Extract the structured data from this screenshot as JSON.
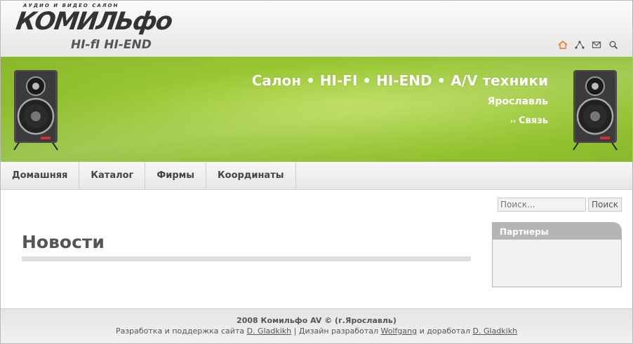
{
  "logo": {
    "tagline": "АУДИО И ВИДЕО САЛОН",
    "name": "КОМИЛЬфо",
    "sub": "HI-fI  HI-END"
  },
  "top_icons": [
    "home-icon",
    "sitemap-icon",
    "mail-icon",
    "search-icon"
  ],
  "banner": {
    "title": "Салон • HI-FI • HI-END • A/V техники",
    "city": "Ярославль",
    "link_arrow": "››",
    "link_label": "Связь"
  },
  "nav": {
    "items": [
      {
        "label": "Домашняя"
      },
      {
        "label": "Каталог"
      },
      {
        "label": "Фирмы"
      },
      {
        "label": "Координаты"
      }
    ]
  },
  "search": {
    "placeholder": "Поиск...",
    "button_label": "Поиск"
  },
  "main": {
    "news_title": "Новости"
  },
  "partners": {
    "title": "Партнеры"
  },
  "footer": {
    "line1": "2008 Комильфо AV © (г.Ярославль)",
    "dev_text": "Разработка и поддержка сайта",
    "dev_link": "D. Gladkikh",
    "sep": "|",
    "design_text": "Дизайн разработал",
    "design_link": "Wolfgang",
    "and_text": "и доработал",
    "and_link": "D. Gladkikh"
  },
  "colors": {
    "banner_green": "#99c733",
    "accent_orange": "#e8752a",
    "text_gray": "#555555"
  }
}
